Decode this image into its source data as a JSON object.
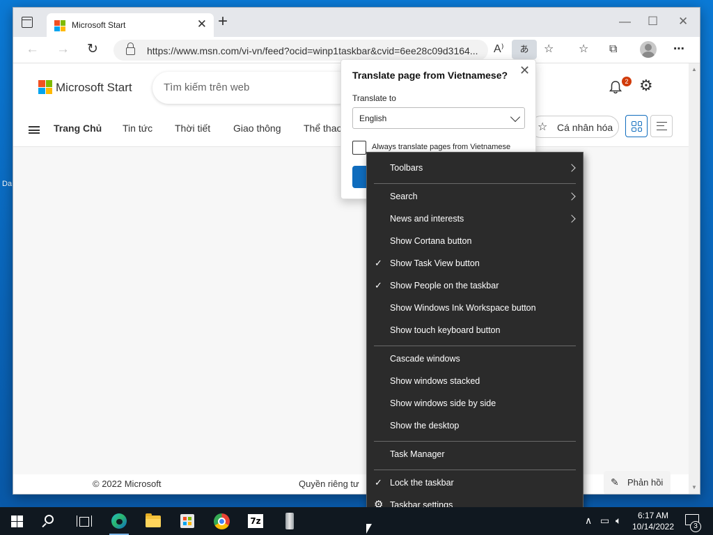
{
  "browser": {
    "tab_title": "Microsoft Start",
    "tab_close": "✕",
    "new_tab": "+",
    "url": "https://www.msn.com/vi-vn/feed?ocid=winp1taskbar&cvid=6ee28c09d3164...",
    "read_aloud": "A⁾",
    "translate_glyph": "あ",
    "more": "⋯"
  },
  "page": {
    "brand": "Microsoft Start",
    "search_placeholder": "Tìm kiếm trên web",
    "notification_count": "2",
    "nav": [
      "Trang Chủ",
      "Tin tức",
      "Thời tiết",
      "Giao thông",
      "Thể thao"
    ],
    "personalize": "Cá nhân hóa",
    "footer_copyright": "© 2022 Microsoft",
    "footer_privacy": "Quyền riêng tư",
    "feedback": "Phản hồi"
  },
  "translate_popup": {
    "title": "Translate page from Vietnamese?",
    "translate_to_label": "Translate to",
    "language": "English",
    "always_translate_label": "Always translate pages from Vietnamese",
    "always_translate_checked": false
  },
  "context_menu": {
    "items": [
      {
        "label": "Toolbars",
        "submenu": true,
        "checked": false
      },
      {
        "label": "Search",
        "submenu": true,
        "checked": false
      },
      {
        "label": "News and interests",
        "submenu": true,
        "checked": false
      },
      {
        "label": "Show Cortana button",
        "submenu": false,
        "checked": false
      },
      {
        "label": "Show Task View button",
        "submenu": false,
        "checked": true
      },
      {
        "label": "Show People on the taskbar",
        "submenu": false,
        "checked": true
      },
      {
        "label": "Show Windows Ink Workspace button",
        "submenu": false,
        "checked": false
      },
      {
        "label": "Show touch keyboard button",
        "submenu": false,
        "checked": false
      },
      {
        "label": "Cascade windows",
        "submenu": false,
        "checked": false
      },
      {
        "label": "Show windows stacked",
        "submenu": false,
        "checked": false
      },
      {
        "label": "Show windows side by side",
        "submenu": false,
        "checked": false
      },
      {
        "label": "Show the desktop",
        "submenu": false,
        "checked": false
      },
      {
        "label": "Task Manager",
        "submenu": false,
        "checked": false
      },
      {
        "label": "Lock the taskbar",
        "submenu": false,
        "checked": true
      },
      {
        "label": "Taskbar settings",
        "submenu": false,
        "checked": false,
        "icon": "gear-icon"
      }
    ]
  },
  "taskbar": {
    "apps": [
      "start-icon",
      "search-icon",
      "task-view-icon",
      "edge-icon",
      "file-explorer-icon",
      "store-icon",
      "chrome-icon",
      "7zip-icon",
      "app-icon"
    ],
    "zip_label": "7z",
    "time": "6:17 AM",
    "date": "10/14/2022",
    "notification_count": "3"
  },
  "desktop": {
    "partial_label": "Da"
  },
  "colors": {
    "accent": "#0f6cbd",
    "menu_bg": "#2b2b2b",
    "taskbar_bg": "#101820",
    "badge": "#d13b0a"
  }
}
